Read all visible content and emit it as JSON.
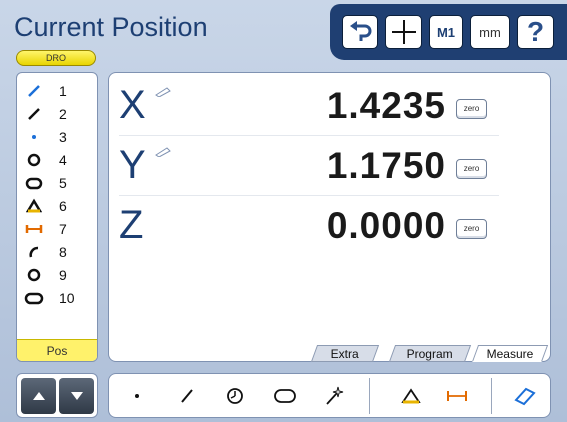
{
  "header": {
    "title": "Current Position",
    "badge": "DRO"
  },
  "toolbar": {
    "undo_icon": "undo-icon",
    "crosshair_icon": "crosshair-icon",
    "m1_label": "M1",
    "units_label": "mm",
    "help_label": "?"
  },
  "features": [
    {
      "icon": "line-icon",
      "number": "1"
    },
    {
      "icon": "line-icon",
      "number": "2"
    },
    {
      "icon": "point-icon",
      "number": "3"
    },
    {
      "icon": "circle-icon",
      "number": "4"
    },
    {
      "icon": "slot-icon",
      "number": "5"
    },
    {
      "icon": "angle-icon",
      "number": "6"
    },
    {
      "icon": "distance-icon",
      "number": "7"
    },
    {
      "icon": "arc-icon",
      "number": "8"
    },
    {
      "icon": "circle-icon",
      "number": "9"
    },
    {
      "icon": "slot-icon",
      "number": "10"
    }
  ],
  "feature_footer": "Pos",
  "axes": [
    {
      "letter": "X",
      "value": "1.4235",
      "zero_label": "zero",
      "has_pencil": true
    },
    {
      "letter": "Y",
      "value": "1.1750",
      "zero_label": "zero",
      "has_pencil": true
    },
    {
      "letter": "Z",
      "value": "0.0000",
      "zero_label": "zero",
      "has_pencil": false
    }
  ],
  "tabs": [
    "Extra",
    "Program",
    "Measure"
  ],
  "active_tab": "Measure",
  "measure_tools": [
    "point-icon",
    "line-icon",
    "circle-icon",
    "slot-icon",
    "magic-wand-icon",
    "angle-icon",
    "distance-icon",
    "skew-icon"
  ],
  "colors": {
    "accent": "#1d3f73",
    "highlight": "#fff26b",
    "background": "#b9c9de"
  }
}
